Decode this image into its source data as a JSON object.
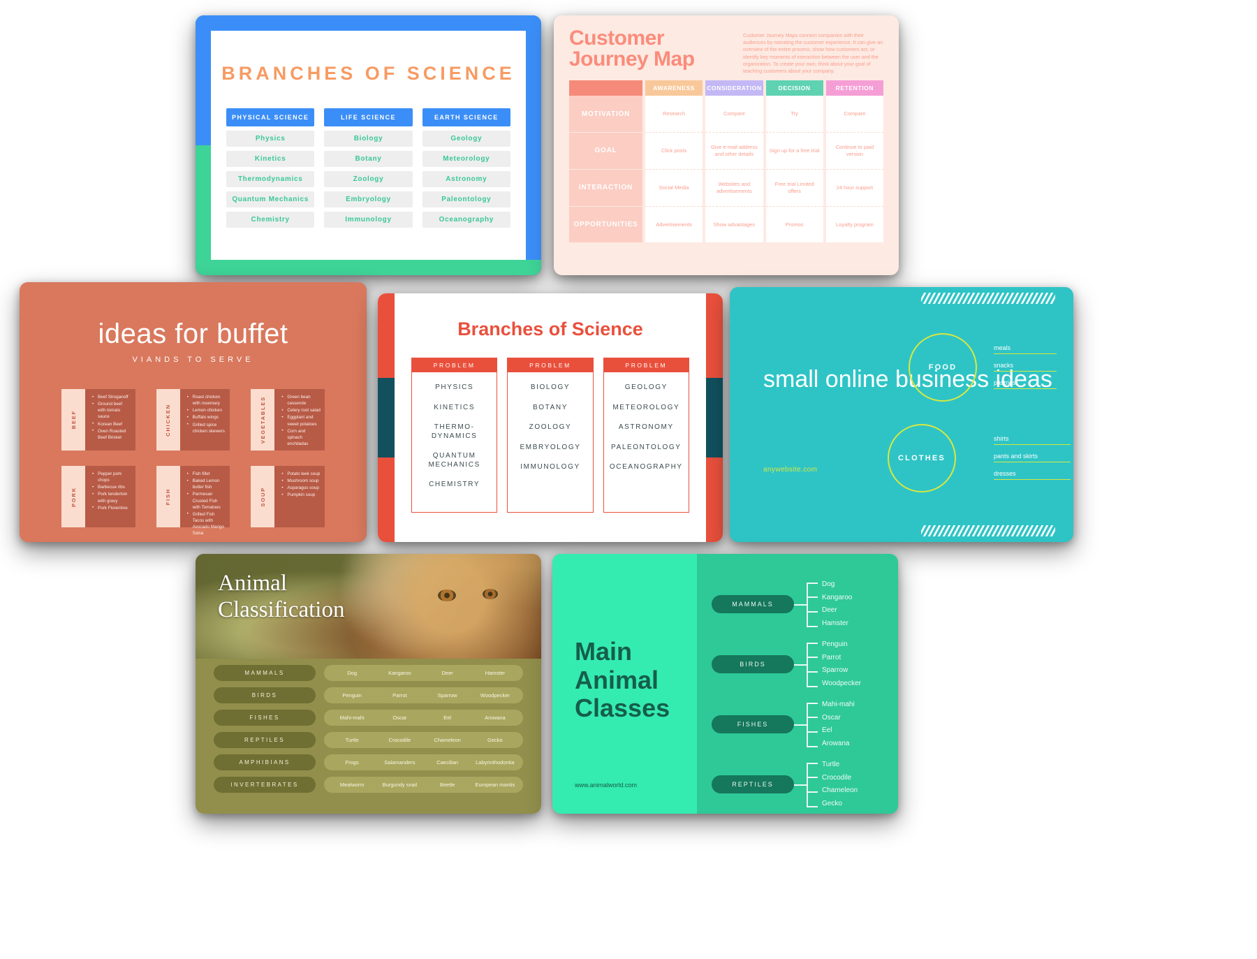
{
  "cards": {
    "science_blue": {
      "title": "BRANCHES OF SCIENCE",
      "columns": [
        {
          "head": "PHYSICAL SCIENCE",
          "items": [
            "Physics",
            "Kinetics",
            "Thermodynamics",
            "Quantum Mechanics",
            "Chemistry"
          ]
        },
        {
          "head": "LIFE SCIENCE",
          "items": [
            "Biology",
            "Botany",
            "Zoology",
            "Embryology",
            "Immunology"
          ]
        },
        {
          "head": "EARTH SCIENCE",
          "items": [
            "Geology",
            "Meteorology",
            "Astronomy",
            "Paleontology",
            "Oceanography"
          ]
        }
      ],
      "colors": {
        "blue": "#3b8ef7",
        "green": "#3ed397",
        "orange": "#f79b63"
      }
    },
    "journey": {
      "title_line1": "Customer",
      "title_line2": "Journey Map",
      "description": "Customer Journey Maps connect companies with their audiences by narrating the customer experience. It can give an overview of the entire process, show how customers act, or identify key moments of interaction between the user and the organization. To create your own, think about your goal of teaching customers about your company.",
      "column_headers": [
        "",
        "AWARENESS",
        "CONSIDERATION",
        "DECISION",
        "RETENTION"
      ],
      "row_labels": [
        "MOTIVATION",
        "GOAL",
        "INTERACTION",
        "OPPORTUNITIES"
      ],
      "rows": [
        [
          "Research",
          "Compare",
          "Try",
          "Compare"
        ],
        [
          "Click posts",
          "Give e-mail address and other details",
          "Sign up for a free trial",
          "Continue to paid version"
        ],
        [
          "Social Media",
          "Websites and advertisements",
          "Free trial Limited offers",
          "24 hour support"
        ],
        [
          "Advertisements",
          "Show advantages",
          "Promos",
          "Loyalty program"
        ]
      ],
      "colors": {
        "bg": "#fdeae2",
        "coral": "#fa8c7c",
        "awareness": "#f9c89a",
        "consideration": "#c3b8f5",
        "decision": "#5fd2b2",
        "retention": "#f59ed6"
      }
    },
    "buffet": {
      "title": "ideas for buffet",
      "subtitle": "VIANDS TO SERVE",
      "groups": [
        {
          "label": "BEEF",
          "items": [
            "Beef Stroganoff",
            "Ground beef with tomato sauce",
            "Korean Beef",
            "Oven Roasted Beef Brisket"
          ]
        },
        {
          "label": "CHICKEN",
          "items": [
            "Roast chicken with rosemary",
            "Lemon chicken",
            "Buffalo wings",
            "Grilled spice chicken skewers"
          ]
        },
        {
          "label": "VEGETABLES",
          "items": [
            "Green bean casserole",
            "Celery root salad",
            "Eggplant and sweet potatoes",
            "Corn and spinach enchiladas"
          ]
        },
        {
          "label": "PORK",
          "items": [
            "Pepper pork chops",
            "Barbecue ribs",
            "Pork tenderloin with gravy",
            "Pork Florentine"
          ]
        },
        {
          "label": "FISH",
          "items": [
            "Fish fillet",
            "Baked Lemon butter fish",
            "Parmesan Crusted Fish with Tomatoes",
            "Grilled Fish Tacos with Avocado Mango Salsa"
          ]
        },
        {
          "label": "SOUP",
          "items": [
            "Potato leek soup",
            "Mushroom soup",
            "Asparagus soup",
            "Pumpkin soup"
          ]
        }
      ],
      "colors": {
        "bg": "#d9785d",
        "panel": "#b75a46",
        "tab": "#fbddd0"
      }
    },
    "science_red": {
      "title": "Branches of Science",
      "column_header": "PROBLEM",
      "columns": [
        [
          "PHYSICS",
          "KINETICS",
          "THERMO-DYNAMICS",
          "QUANTUM MECHANICS",
          "CHEMISTRY"
        ],
        [
          "BIOLOGY",
          "BOTANY",
          "ZOOLOGY",
          "EMBRYOLOGY",
          "IMMUNOLOGY"
        ],
        [
          "GEOLOGY",
          "METEOROLOGY",
          "ASTRONOMY",
          "PALEONTOLOGY",
          "OCEANOGRAPHY"
        ]
      ],
      "colors": {
        "red": "#e9503c",
        "teal": "#12505e"
      }
    },
    "teal_business": {
      "title": "small online business ideas",
      "url": "anywebsite.com",
      "circles": [
        {
          "label": "FOOD",
          "items": [
            "meals",
            "snacks",
            "pastries"
          ]
        },
        {
          "label": "CLOTHES",
          "items": [
            "shirts",
            "pants and skirts",
            "dresses"
          ]
        }
      ],
      "colors": {
        "bg": "#2ec4c6",
        "accent": "#d9e83f"
      }
    },
    "animal_classification": {
      "title_line1": "Animal",
      "title_line2": "Classification",
      "rows": [
        {
          "label": "MAMMALS",
          "items": [
            "Dog",
            "Kangaroo",
            "Deer",
            "Hamster"
          ]
        },
        {
          "label": "BIRDS",
          "items": [
            "Penguin",
            "Parrot",
            "Sparrow",
            "Woodpecker"
          ]
        },
        {
          "label": "FISHES",
          "items": [
            "Mahi-mahi",
            "Oscar",
            "Eel",
            "Arowana"
          ]
        },
        {
          "label": "REPTILES",
          "items": [
            "Turtle",
            "Crocodile",
            "Chameleon",
            "Gecko"
          ]
        },
        {
          "label": "AMPHIBIANS",
          "items": [
            "Frogs",
            "Salamanders",
            "Caecilian",
            "Labyrinthodontia"
          ]
        },
        {
          "label": "INVERTEBRATES",
          "items": [
            "Mealworm",
            "Burgundy snail",
            "Beetle",
            "European mantis"
          ]
        }
      ],
      "colors": {
        "bg": "#918f4b",
        "pill": "#6f6f33",
        "items_bg": "#a9a75f"
      }
    },
    "main_animal_classes": {
      "title_line1": "Main",
      "title_line2": "Animal",
      "title_line3": "Classes",
      "url": "www.animalworld.com",
      "groups": [
        {
          "label": "MAMMALS",
          "items": [
            "Dog",
            "Kangaroo",
            "Deer",
            "Hamster"
          ]
        },
        {
          "label": "BIRDS",
          "items": [
            "Penguin",
            "Parrot",
            "Sparrow",
            "Woodpecker"
          ]
        },
        {
          "label": "FISHES",
          "items": [
            "Mahi-mahi",
            "Oscar",
            "Eel",
            "Arowana"
          ]
        },
        {
          "label": "REPTILES",
          "items": [
            "Turtle",
            "Crocodile",
            "Chameleon",
            "Gecko"
          ]
        }
      ],
      "colors": {
        "bg": "#34ecb0",
        "panel": "#2ec996",
        "pill": "#15775b",
        "title": "#165e49"
      }
    }
  }
}
